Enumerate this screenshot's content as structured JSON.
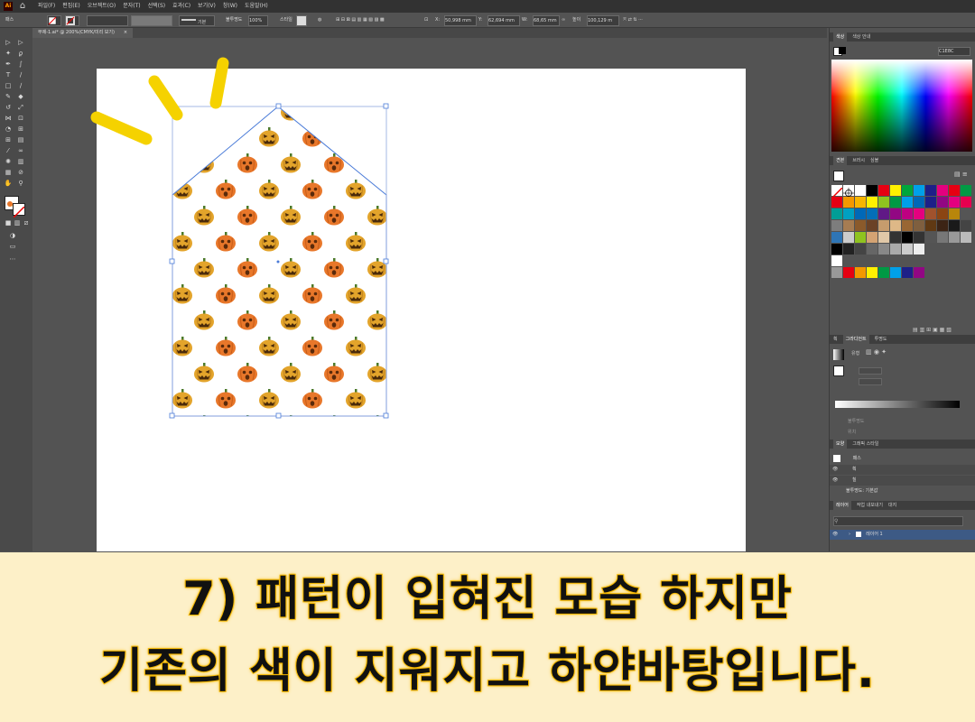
{
  "app": {
    "logo_text": "Ai",
    "menu": [
      "파일(F)",
      "편집(E)",
      "오브젝트(O)",
      "문자(T)",
      "선택(S)",
      "효과(C)",
      "보기(V)",
      "창(W)",
      "도움말(H)"
    ]
  },
  "control_bar": {
    "selection_label": "패스",
    "stroke_style_label": "기본",
    "opacity_label": "불투명도",
    "opacity_value": "100%",
    "style_label": "스타일",
    "x_value": "50,998 mm",
    "y_value": "62,694 mm",
    "w_value": "68,65 mm",
    "h_label": "높이",
    "h_value": "100,129 m"
  },
  "document": {
    "tab_title": "무제-1.ai* @ 200%(CMYK/미리 보기)",
    "close_glyph": "×"
  },
  "panels": {
    "color": {
      "tabs": [
        "색상",
        "색상 안내"
      ],
      "hex_value": "C1E8C"
    },
    "swatches": {
      "tabs": [
        "견본",
        "브러시",
        "심볼"
      ]
    },
    "gradient": {
      "tabs": [
        "획",
        "그라디언트",
        "투명도"
      ],
      "type_label": "유형",
      "opacity_label": "불투명도",
      "position_label": "위치"
    },
    "appearance": {
      "tabs": [
        "모양",
        "그래픽 스타일"
      ],
      "title": "패스",
      "stroke_label": "획",
      "fill_label": "칠",
      "opacity_label": "불투명도: 기본값"
    },
    "layers": {
      "tabs": [
        "레이어",
        "작업 내보내기",
        "대지"
      ],
      "layer_name": "레이어 1"
    }
  },
  "caption": {
    "line1": "7) 패턴이 입혀진 모습 하지만",
    "line2": "기존의 색이 지워지고 하얀바탕입니다."
  },
  "colors": {
    "accent_yellow": "#f5d200",
    "caption_bg": "#fdf0c8",
    "selection_blue": "#4a7bd8",
    "pumpkin_orange": "#e8772a",
    "pumpkin_yellow": "#e3a42b"
  }
}
